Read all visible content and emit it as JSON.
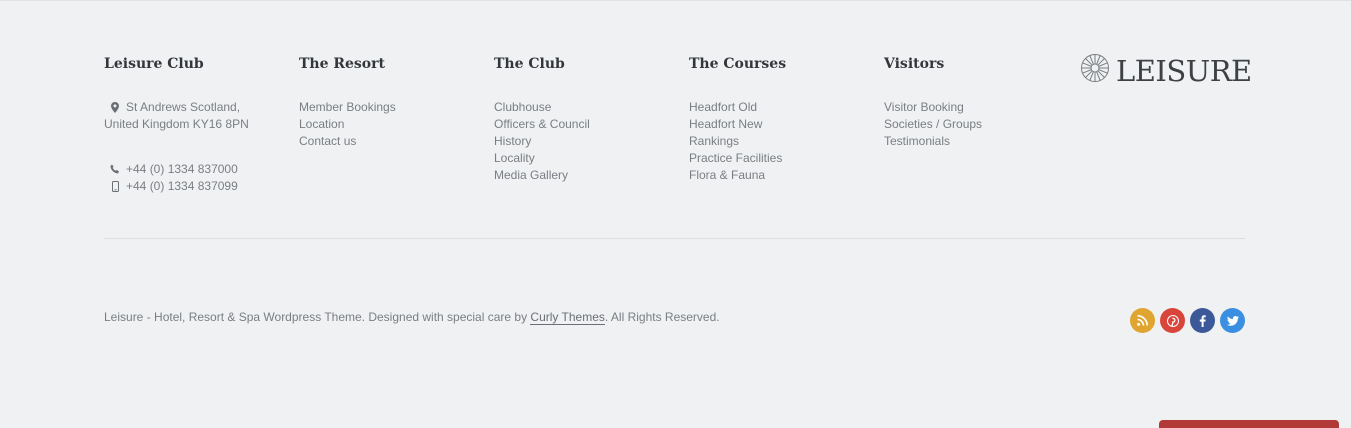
{
  "columns": {
    "leisure": {
      "title": "Leisure Club",
      "address_line1": "St Andrews Scotland,",
      "address_line2": "United Kingdom KY16 8PN",
      "phone": "+44 (0) 1334 837000",
      "mobile": "+44 (0) 1334 837099"
    },
    "resort": {
      "title": "The Resort",
      "links": [
        "Member Bookings",
        "Location",
        "Contact us"
      ]
    },
    "club": {
      "title": "The Club",
      "links": [
        "Clubhouse",
        "Officers & Council",
        "History",
        "Locality",
        "Media Gallery"
      ]
    },
    "courses": {
      "title": "The Courses",
      "links": [
        "Headfort Old",
        "Headfort New",
        "Rankings",
        "Practice Facilities",
        "Flora & Fauna"
      ]
    },
    "visitors": {
      "title": "Visitors",
      "links": [
        "Visitor Booking",
        "Societies / Groups",
        "Testimonials"
      ]
    }
  },
  "logo": {
    "text": "LEISURE",
    "icon": "sunburst-logo-icon"
  },
  "copyright": {
    "prefix": "Leisure - Hotel, Resort & Spa Wordpress Theme. Designed with special care by ",
    "link": "Curly Themes",
    "suffix": ". All Rights Reserved."
  },
  "social": [
    {
      "icon": "rss-icon",
      "color": "#e0a430"
    },
    {
      "icon": "pinterest-icon",
      "color": "#d9453b"
    },
    {
      "icon": "facebook-icon",
      "color": "#3b5998"
    },
    {
      "icon": "twitter-icon",
      "color": "#3b8fe0"
    }
  ]
}
